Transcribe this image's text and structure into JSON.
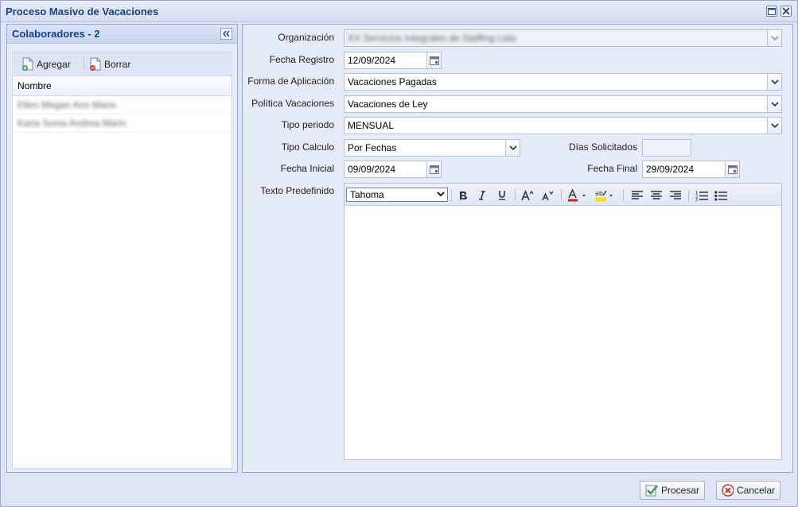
{
  "window": {
    "title": "Proceso Masivo de Vacaciones"
  },
  "left": {
    "title": "Colaboradores - 2",
    "toolbar": {
      "add_label": "Agregar",
      "delete_label": "Borrar"
    },
    "grid": {
      "header": "Nombre",
      "rows": [
        "Ellen Megan Ann Marie",
        "Karla Sonia Andrea Marin"
      ]
    }
  },
  "form": {
    "organizacion": {
      "label": "Organización",
      "value": "XX Servicios Integrales de Staffing Ltda"
    },
    "fecha_registro": {
      "label": "Fecha Registro",
      "value": "12/09/2024"
    },
    "forma_aplicacion": {
      "label": "Forma de Aplicación",
      "value": "Vacaciones Pagadas"
    },
    "politica": {
      "label": "Política Vacaciones",
      "value": "Vacaciones de Ley"
    },
    "tipo_periodo": {
      "label": "Tipo periodo",
      "value": "MENSUAL"
    },
    "tipo_calculo": {
      "label": "Tipo Calculo",
      "value": "Por Fechas"
    },
    "dias_solicitados": {
      "label": "Días Solicitados",
      "value": ""
    },
    "fecha_inicial": {
      "label": "Fecha Inicial",
      "value": "09/09/2024"
    },
    "fecha_final": {
      "label": "Fecha Final",
      "value": "29/09/2024"
    },
    "texto": {
      "label": "Texto Predefinido",
      "font": "Tahoma",
      "content": ""
    }
  },
  "footer": {
    "process_label": "Procesar",
    "cancel_label": "Cancelar"
  },
  "colors": {
    "title_text": "#15428b",
    "accent_red": "#cc2222",
    "highlight_yellow": "#f2e400"
  }
}
